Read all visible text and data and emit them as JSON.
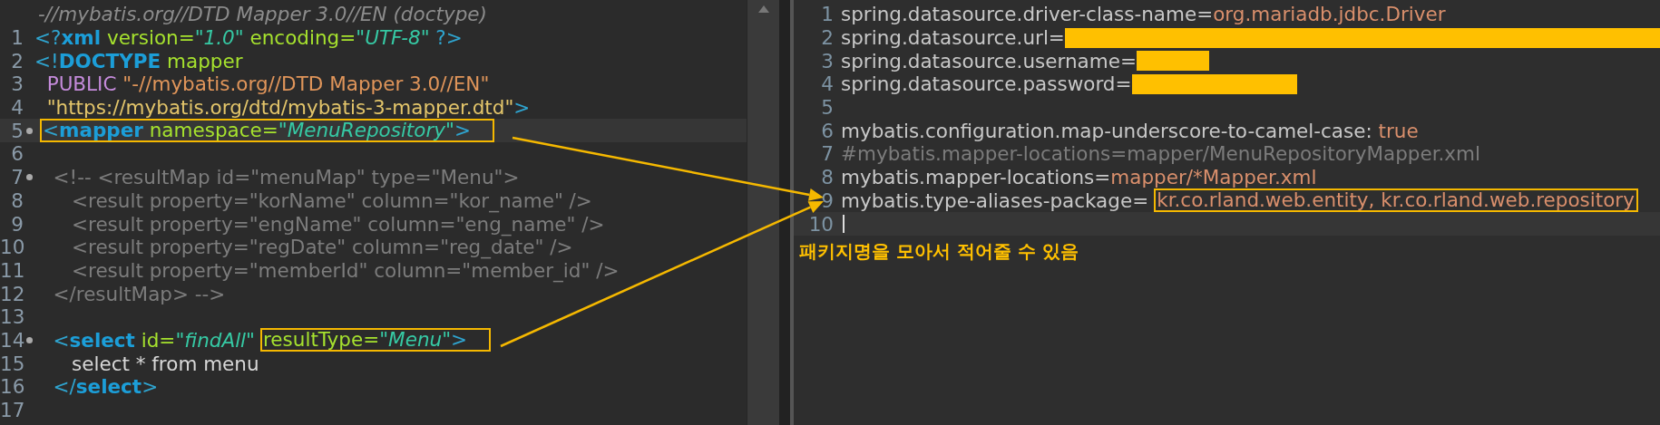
{
  "xml_editor": {
    "header": "-//mybatis.org//DTD Mapper 3.0//EN (doctype)",
    "lines": [
      {
        "number": "1",
        "current": false,
        "foldable": false,
        "tokens": [
          {
            "t": "<?",
            "kind": "punct"
          },
          {
            "t": "xml",
            "kind": "tag"
          },
          {
            "t": " version=",
            "kind": "attr"
          },
          {
            "t": "\"1.0\"",
            "kind": "str"
          },
          {
            "t": " encoding=",
            "kind": "attr"
          },
          {
            "t": "\"UTF-8\"",
            "kind": "str"
          },
          {
            "t": " ?>",
            "kind": "punct"
          }
        ]
      },
      {
        "number": "2",
        "current": false,
        "foldable": false,
        "tokens": [
          {
            "t": "<!",
            "kind": "punct"
          },
          {
            "t": "DOCTYPE",
            "kind": "tag"
          },
          {
            "t": " mapper",
            "kind": "attr"
          }
        ]
      },
      {
        "number": "3",
        "current": false,
        "foldable": false,
        "tokens": [
          {
            "t": "  PUBLIC ",
            "kind": "keyword"
          },
          {
            "t": "\"-//mybatis.org//DTD Mapper 3.0//EN\"",
            "kind": "pubid"
          }
        ]
      },
      {
        "number": "4",
        "current": false,
        "foldable": false,
        "tokens": [
          {
            "t": "  \"https://mybatis.org/dtd/mybatis-3-mapper.dtd\"",
            "kind": "url"
          },
          {
            "t": ">",
            "kind": "punct"
          }
        ]
      },
      {
        "number": "5",
        "current": true,
        "foldable": true,
        "tokens": [
          {
            "kind": "box",
            "tokens": [
              {
                "t": "<",
                "kind": "punct"
              },
              {
                "t": "mapper",
                "kind": "tag"
              },
              {
                "t": " namespace=",
                "kind": "attr"
              },
              {
                "t": "\"MenuRepository\"",
                "kind": "str"
              },
              {
                "t": ">",
                "kind": "punct"
              }
            ]
          }
        ]
      },
      {
        "number": "6",
        "current": false,
        "foldable": false
      },
      {
        "number": "7",
        "current": false,
        "foldable": true,
        "tokens": [
          {
            "t": "   <!-- <resultMap id=\"menuMap\" type=\"Menu\">",
            "kind": "comment"
          }
        ]
      },
      {
        "number": "8",
        "current": false,
        "foldable": false,
        "tokens": [
          {
            "t": "      <result property=\"korName\" column=\"kor_name\" />",
            "kind": "comment"
          }
        ]
      },
      {
        "number": "9",
        "current": false,
        "foldable": false,
        "tokens": [
          {
            "t": "      <result property=\"engName\" column=\"eng_name\" />",
            "kind": "comment"
          }
        ]
      },
      {
        "number": "10",
        "current": false,
        "foldable": false,
        "tokens": [
          {
            "t": "      <result property=\"regDate\" column=\"reg_date\" />",
            "kind": "comment"
          }
        ]
      },
      {
        "number": "11",
        "current": false,
        "foldable": false,
        "tokens": [
          {
            "t": "      <result property=\"memberId\" column=\"member_id\" />",
            "kind": "comment"
          }
        ]
      },
      {
        "number": "12",
        "current": false,
        "foldable": false,
        "tokens": [
          {
            "t": "   </resultMap> -->",
            "kind": "comment"
          }
        ]
      },
      {
        "number": "13",
        "current": false,
        "foldable": false
      },
      {
        "number": "14",
        "current": false,
        "foldable": true,
        "tokens": [
          {
            "t": "   <",
            "kind": "punct"
          },
          {
            "t": "select",
            "kind": "tag"
          },
          {
            "t": " id=",
            "kind": "attr"
          },
          {
            "t": "\"findAll\"",
            "kind": "str"
          },
          {
            "kind": "box",
            "tokens": [
              {
                "t": "resultType=",
                "kind": "attr"
              },
              {
                "t": "\"Menu\"",
                "kind": "str"
              },
              {
                "t": ">",
                "kind": "punct"
              }
            ]
          }
        ]
      },
      {
        "number": "15",
        "current": false,
        "foldable": false,
        "tokens": [
          {
            "t": "      select * from menu",
            "kind": "text"
          }
        ]
      },
      {
        "number": "16",
        "current": false,
        "foldable": false,
        "tokens": [
          {
            "t": "   </",
            "kind": "punct"
          },
          {
            "t": "select",
            "kind": "tag"
          },
          {
            "t": ">",
            "kind": "punct"
          }
        ]
      },
      {
        "number": "17",
        "current": false,
        "foldable": false
      }
    ]
  },
  "properties_editor": {
    "lines": [
      {
        "number": "1",
        "current": false,
        "tokens": [
          {
            "t": "spring.datasource.driver-class-name=",
            "kind": "key"
          },
          {
            "t": "org.mariadb.jdbc.Driver",
            "kind": "value"
          }
        ]
      },
      {
        "number": "2",
        "current": false,
        "tokens": [
          {
            "t": "spring.datasource.url=",
            "kind": "key"
          },
          {
            "kind": "redaction"
          }
        ]
      },
      {
        "number": "3",
        "current": false,
        "tokens": [
          {
            "t": "spring.datasource.username=",
            "kind": "key"
          },
          {
            "kind": "redaction"
          }
        ]
      },
      {
        "number": "4",
        "current": false,
        "tokens": [
          {
            "t": "spring.datasource.password=",
            "kind": "key"
          },
          {
            "kind": "redaction"
          }
        ]
      },
      {
        "number": "5",
        "current": false
      },
      {
        "number": "6",
        "current": false,
        "tokens": [
          {
            "t": "mybatis.configuration.map-underscore-to-camel-case: ",
            "kind": "key"
          },
          {
            "t": "true",
            "kind": "value"
          }
        ]
      },
      {
        "number": "7",
        "current": false,
        "tokens": [
          {
            "t": "#mybatis.mapper-locations=mapper/MenuRepositoryMapper.xml",
            "kind": "comment"
          }
        ]
      },
      {
        "number": "8",
        "current": false,
        "tokens": [
          {
            "t": "mybatis.mapper-locations=",
            "kind": "key"
          },
          {
            "t": "mapper/*Mapper.xml",
            "kind": "value"
          }
        ]
      },
      {
        "number": "9",
        "current": false,
        "tokens": [
          {
            "t": "mybatis.type-aliases-package=",
            "kind": "key"
          },
          {
            "kind": "box",
            "tokens": [
              {
                "t": "kr.co.rland.web.entity, kr.co.rland.web.repository",
                "kind": "value"
              }
            ]
          }
        ]
      },
      {
        "number": "10",
        "current": true
      }
    ]
  },
  "note": "패키지명을 모아서 적어줄 수 있음"
}
